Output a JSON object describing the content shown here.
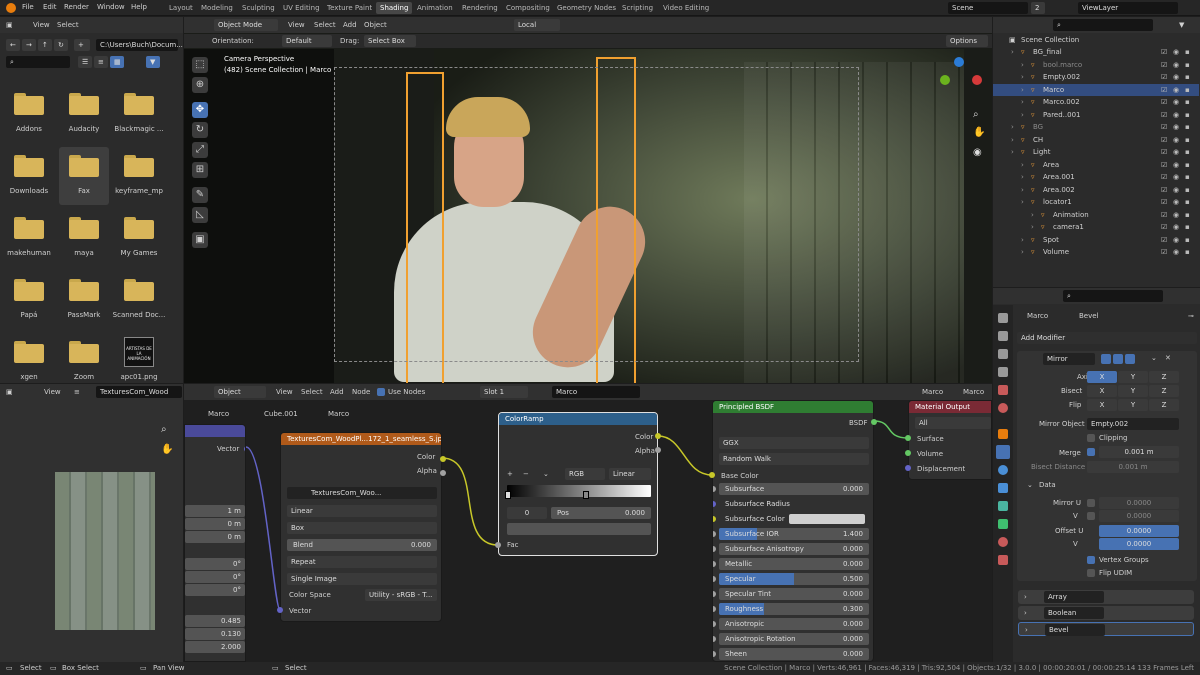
{
  "menu": {
    "file": "File",
    "edit": "Edit",
    "render": "Render",
    "window": "Window",
    "help": "Help"
  },
  "workspaces": [
    "Layout",
    "Modeling",
    "Sculpting",
    "UV Editing",
    "Texture Paint",
    "Shading",
    "Animation",
    "Rendering",
    "Compositing",
    "Geometry Nodes",
    "Scripting",
    "Video Editing"
  ],
  "scene": {
    "name": "Scene",
    "users": "2",
    "view_layer": "ViewLayer"
  },
  "filebrowser": {
    "view": "View",
    "select": "Select",
    "path": "C:\\Users\\Buch\\Docum...",
    "items": [
      {
        "label": "Addons"
      },
      {
        "label": "Audacity"
      },
      {
        "label": "Blackmagic ..."
      },
      {
        "label": "Downloads"
      },
      {
        "label": "Fax"
      },
      {
        "label": "keyframe_mp"
      },
      {
        "label": "makehuman"
      },
      {
        "label": "maya"
      },
      {
        "label": "My Games"
      },
      {
        "label": "Papá"
      },
      {
        "label": "PassMark"
      },
      {
        "label": "Scanned Doc..."
      },
      {
        "label": "xgen"
      },
      {
        "label": "Zoom"
      },
      {
        "label": "apc01.png"
      }
    ],
    "thumb_text": "ARTISTAS DE LA ANIMACIÓN"
  },
  "viewport": {
    "mode": "Object Mode",
    "view": "View",
    "select": "Select",
    "add": "Add",
    "object": "Object",
    "transform": "Local",
    "orientation_label": "Orientation:",
    "orientation": "Default",
    "drag_label": "Drag:",
    "drag": "Select Box",
    "options": "Options",
    "camera_title": "Camera Perspective",
    "scene_info": "(482) Scene Collection | Marco"
  },
  "outliner": {
    "title": "Scene Collection",
    "rows": [
      {
        "label": "BG_final"
      },
      {
        "label": "bool.marco"
      },
      {
        "label": "Empty.002"
      },
      {
        "label": "Marco"
      },
      {
        "label": "Marco.002"
      },
      {
        "label": "Pared..001"
      },
      {
        "label": "BG"
      },
      {
        "label": "CH"
      },
      {
        "label": "Light"
      },
      {
        "label": "Area"
      },
      {
        "label": "Area.001"
      },
      {
        "label": "Area.002"
      },
      {
        "label": "locator1"
      },
      {
        "label": "Animation"
      },
      {
        "label": "camera1"
      },
      {
        "label": "Spot"
      },
      {
        "label": "Volume"
      }
    ]
  },
  "imgeditor": {
    "view": "View",
    "image": "TexturesCom_Wood"
  },
  "nodeeditor": {
    "object": "Object",
    "view": "View",
    "select": "Select",
    "add": "Add",
    "node": "Node",
    "use_nodes": "Use Nodes",
    "slot": "Slot 1",
    "material": "Marco",
    "breadcrumb": [
      "Marco",
      "Cube.001",
      "Marco"
    ],
    "right_obj": "Marco",
    "right_mat": "Marco"
  },
  "nodes": {
    "left_partial": {
      "vector": "Vector",
      "fields": [
        "1 m",
        "0 m",
        "0 m",
        "0°",
        "0°",
        "0°",
        "0.485",
        "0.130",
        "2.000"
      ]
    },
    "image_texture": {
      "title": "TexturesCom_WoodPl...172_1_seamless_S.jpg",
      "out_color": "Color",
      "out_alpha": "Alpha",
      "image": "TexturesCom_Woo...",
      "interp": "Linear",
      "proj": "Box",
      "blend_label": "Blend",
      "blend": "0.000",
      "ext": "Repeat",
      "source": "Single Image",
      "cs_label": "Color Space",
      "cs": "Utility - sRGB - T...",
      "in_vector": "Vector"
    },
    "colorramp": {
      "title": "ColorRamp",
      "out_color": "Color",
      "out_alpha": "Alpha",
      "mode": "RGB",
      "interp": "Linear",
      "index": "0",
      "pos_label": "Pos",
      "pos": "0.000",
      "in_fac": "Fac"
    },
    "bsdf": {
      "title": "Principled BSDF",
      "out": "BSDF",
      "dist": "GGX",
      "sss_method": "Random Walk",
      "base_color": "Base Color",
      "params": [
        {
          "label": "Subsurface",
          "value": "0.000",
          "fill": 0
        },
        {
          "label": "Subsurface Radius",
          "value": "",
          "fill": 0
        },
        {
          "label": "Subsurface Color",
          "value": "",
          "fill": 0
        },
        {
          "label": "Subsurface IOR",
          "value": "1.400",
          "fill": 0.25
        },
        {
          "label": "Subsurface Anisotropy",
          "value": "0.000",
          "fill": 0
        },
        {
          "label": "Metallic",
          "value": "0.000",
          "fill": 0
        },
        {
          "label": "Specular",
          "value": "0.500",
          "fill": 0.5
        },
        {
          "label": "Specular Tint",
          "value": "0.000",
          "fill": 0
        },
        {
          "label": "Roughness",
          "value": "0.300",
          "fill": 0.3
        },
        {
          "label": "Anisotropic",
          "value": "0.000",
          "fill": 0
        },
        {
          "label": "Anisotropic Rotation",
          "value": "0.000",
          "fill": 0
        },
        {
          "label": "Sheen",
          "value": "0.000",
          "fill": 0
        }
      ]
    },
    "output": {
      "title": "Material Output",
      "target": "All",
      "surface": "Surface",
      "volume": "Volume",
      "displacement": "Displacement"
    }
  },
  "properties": {
    "object": "Marco",
    "modifier": "Bevel",
    "add_modifier": "Add Modifier",
    "mirror": {
      "name": "Mirror",
      "axis": "Axis",
      "bisect": "Bisect",
      "flip": "Flip",
      "x": "X",
      "y": "Y",
      "z": "Z",
      "mirror_object_label": "Mirror Object",
      "mirror_object": "Empty.002",
      "clipping": "Clipping",
      "merge_label": "Merge",
      "merge": "0.001 m",
      "bisect_dist_label": "Bisect Distance",
      "bisect_dist": "0.001 m",
      "data": "Data",
      "mirror_u": "Mirror U",
      "v": "V",
      "mu": "0.0000",
      "mv": "0.0000",
      "offset_u": "Offset U",
      "ou": "0.0000",
      "ov": "0.0000",
      "vertex_groups": "Vertex Groups",
      "flip_udim": "Flip UDIM"
    },
    "stack": [
      "Array",
      "Boolean",
      "Bevel"
    ]
  },
  "status": {
    "select": "Select",
    "box_select": "Box Select",
    "pan_view": "Pan View",
    "select2": "Select",
    "info": "Scene Collection | Marco | Verts:46,961 | Faces:46,319 | Tris:92,504 | Objects:1/32 | 3.0.0 | 00:00:20:01 / 00:00:25:14  133 Frames Left"
  },
  "colors": {
    "accent": "#4772b3",
    "folder": "#d8b55a",
    "texture_header": "#b05a1a",
    "converter_header": "#2d5f8a",
    "shader_header": "#2f7d32",
    "output_header": "#7a2a35",
    "socket_yellow": "#c7c729",
    "socket_grey": "#a1a1a1",
    "socket_purple": "#6363c7",
    "socket_green": "#63c763"
  }
}
